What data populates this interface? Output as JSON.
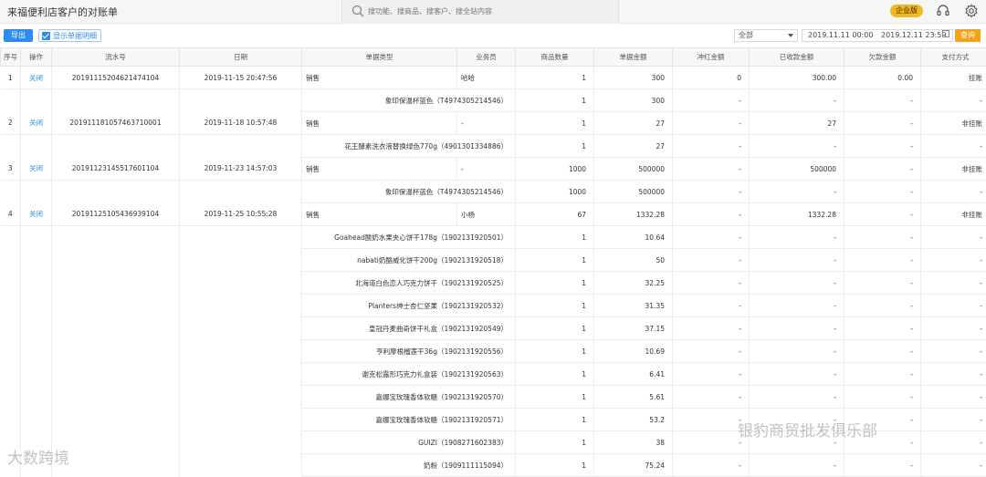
{
  "header": {
    "title": "来福便利店客户的对账单",
    "search_placeholder": "搜功能、搜商品、搜客户、搜全站内容",
    "edition_badge": "企业版",
    "icons": [
      "headset-icon",
      "gear-icon"
    ]
  },
  "toolbar": {
    "export_label": "导出",
    "show_detail_label": "显示单据明细",
    "show_detail_checked": true,
    "type_filter": "全部",
    "date_start": "2019.11.11 00:00",
    "date_separator": "-",
    "date_end": "2019.12.11 23:59",
    "query_label": "查询"
  },
  "table": {
    "columns": [
      "序号",
      "操作",
      "流水号",
      "日期",
      "单据类型",
      "业务员",
      "商品数量",
      "单据金额",
      "冲红金额",
      "已收款金额",
      "欠款金额",
      "支付方式"
    ],
    "rows": [
      {
        "kind": "main",
        "no": "1",
        "op": "关闭",
        "serial": "20191115204621474104",
        "date": "2019-11-15 20:47:56",
        "type": "销售",
        "staff": "哈哈",
        "qty": "1",
        "amount": "300",
        "red": "0",
        "paid": "300.00",
        "debt": "0.00",
        "pay": "挂账"
      },
      {
        "kind": "sub",
        "item": "象印保温杯蓝色（T4974305214546）",
        "qty": "1",
        "amount": "300",
        "red": "-",
        "paid": "-",
        "debt": "-",
        "pay": "-"
      },
      {
        "kind": "main",
        "no": "2",
        "op": "关闭",
        "serial": "20191118105746371000​1",
        "date": "2019-11-18 10:57:48",
        "type": "销售",
        "staff": "-",
        "qty": "1",
        "amount": "27",
        "red": "-",
        "paid": "27",
        "debt": "-",
        "pay": "非挂账"
      },
      {
        "kind": "sub",
        "item": "花王酵素洗衣液替换绿色770g（4901301334886）",
        "qty": "1",
        "amount": "27",
        "red": "-",
        "paid": "-",
        "debt": "-",
        "pay": "-"
      },
      {
        "kind": "main",
        "no": "3",
        "op": "关闭",
        "serial": "20191123145517601104",
        "date": "2019-11-23 14:57:03",
        "type": "销售",
        "staff": "-",
        "qty": "1000",
        "amount": "500000",
        "red": "-",
        "paid": "500000",
        "debt": "-",
        "pay": "非挂账"
      },
      {
        "kind": "sub",
        "item": "象印保温杯蓝色（T4974305214546）",
        "qty": "1000",
        "amount": "500000",
        "red": "-",
        "paid": "-",
        "debt": "-",
        "pay": "-"
      },
      {
        "kind": "main",
        "no": "4",
        "op": "关闭",
        "serial": "20191125105436939104",
        "date": "2019-11-25 10:55:28",
        "type": "销售",
        "staff": "小杨",
        "qty": "67",
        "amount": "1332.28",
        "red": "-",
        "paid": "1332.28",
        "debt": "-",
        "pay": "非挂账"
      },
      {
        "kind": "sub",
        "item": "Goahead酸奶水果夹心饼干178g（1902131920501）",
        "qty": "1",
        "amount": "10.64",
        "red": "-",
        "paid": "-",
        "debt": "-",
        "pay": "-"
      },
      {
        "kind": "sub",
        "item": "nabati奶酪威化饼干200g（1902131920518）",
        "qty": "1",
        "amount": "50",
        "red": "-",
        "paid": "-",
        "debt": "-",
        "pay": "-"
      },
      {
        "kind": "sub",
        "item": "北海道白色恋人巧克力饼干（1902131920525）",
        "qty": "1",
        "amount": "32.25",
        "red": "-",
        "paid": "-",
        "debt": "-",
        "pay": "-"
      },
      {
        "kind": "sub",
        "item": "Planters绅士杏仁坚果（1902131920532）",
        "qty": "1",
        "amount": "31.35",
        "red": "-",
        "paid": "-",
        "debt": "-",
        "pay": "-"
      },
      {
        "kind": "sub",
        "item": "皇冠丹麦曲奇饼干礼盒（1902131920549）",
        "qty": "1",
        "amount": "37.15",
        "red": "-",
        "paid": "-",
        "debt": "-",
        "pay": "-"
      },
      {
        "kind": "sub",
        "item": "亨利摩根榴莲干36g（1902131920556）",
        "qty": "1",
        "amount": "10.69",
        "red": "-",
        "paid": "-",
        "debt": "-",
        "pay": "-"
      },
      {
        "kind": "sub",
        "item": "谢克松露形巧克力礼盒装（1902131920563）",
        "qty": "1",
        "amount": "6.41",
        "red": "-",
        "paid": "-",
        "debt": "-",
        "pay": "-"
      },
      {
        "kind": "sub",
        "item": "嘉娜宝玫瑰香体软糖（1902131920570）",
        "qty": "1",
        "amount": "5.61",
        "red": "-",
        "paid": "-",
        "debt": "-",
        "pay": "-"
      },
      {
        "kind": "sub",
        "item": "嘉娜宝玫瑰香体软糖（1902131920571）",
        "qty": "1",
        "amount": "53.2",
        "red": "-",
        "paid": "-",
        "debt": "-",
        "pay": "-"
      },
      {
        "kind": "sub",
        "item": "GUIZI（1908271602383）",
        "qty": "1",
        "amount": "38",
        "red": "-",
        "paid": "-",
        "debt": "-",
        "pay": "-"
      },
      {
        "kind": "sub",
        "item": "奶粉（1909111115094）",
        "qty": "1",
        "amount": "75.24",
        "red": "-",
        "paid": "-",
        "debt": "-",
        "pay": "-"
      }
    ]
  },
  "watermarks": {
    "left": "大数跨境",
    "right": "银豹商贸批发俱乐部"
  },
  "colors": {
    "primary": "#2d8cf0",
    "query_button": "#f3a21a",
    "edition_badge": "#f3b81f"
  }
}
